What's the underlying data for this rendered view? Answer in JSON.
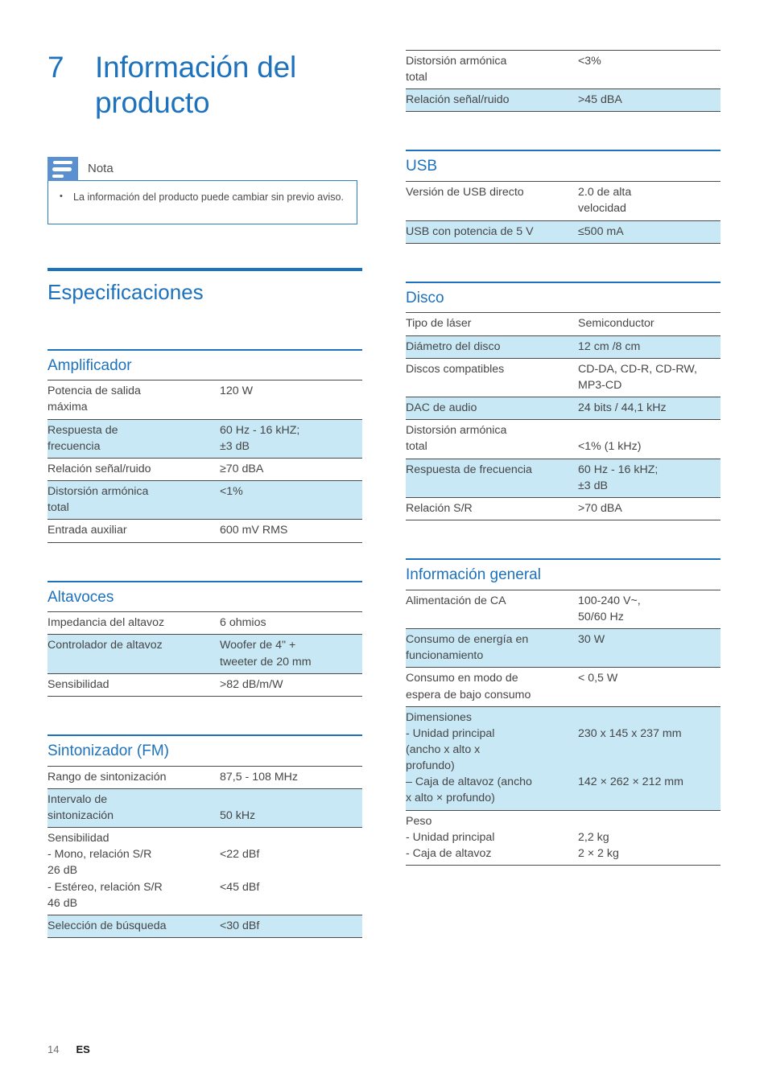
{
  "chapter": {
    "number": "7",
    "title": "Información del producto"
  },
  "note": {
    "label": "Nota",
    "bullet": "•",
    "text": "La información del producto puede cambiar sin previo aviso."
  },
  "specifications": {
    "heading": "Especificaciones"
  },
  "sections": {
    "amplificador": {
      "title": "Amplificador",
      "rows": [
        {
          "label": "Potencia de salida\nmáxima",
          "value": "120 W",
          "highlight": false
        },
        {
          "label": "Respuesta de\nfrecuencia",
          "value": "60 Hz - 16 kHZ;\n±3 dB",
          "highlight": true
        },
        {
          "label": "Relación señal/ruido",
          "value": "≥70 dBA",
          "highlight": false
        },
        {
          "label": "Distorsión armónica\ntotal",
          "value": "<1%",
          "highlight": true
        },
        {
          "label": "Entrada auxiliar",
          "value": "600 mV RMS",
          "highlight": false
        }
      ]
    },
    "altavoces": {
      "title": "Altavoces",
      "rows": [
        {
          "label": "Impedancia del altavoz",
          "value": "6 ohmios",
          "highlight": false
        },
        {
          "label": "Controlador de altavoz",
          "value": "Woofer de 4\" +\ntweeter de 20 mm",
          "highlight": true
        },
        {
          "label": "Sensibilidad",
          "value": ">82 dB/m/W",
          "highlight": false
        }
      ]
    },
    "sintonizador": {
      "title": "Sintonizador (FM)",
      "rows": [
        {
          "label": "Rango de sintonización",
          "value": "87,5 - 108 MHz",
          "highlight": false
        },
        {
          "label": "Intervalo de\nsintonización",
          "value": "\n50 kHz",
          "highlight": true
        },
        {
          "label": "Sensibilidad\n- Mono, relación S/R\n26 dB\n- Estéreo, relación S/R\n46 dB",
          "value": "\n<22 dBf\n\n<45 dBf",
          "highlight": false
        },
        {
          "label": "Selección de búsqueda",
          "value": "<30 dBf",
          "highlight": true
        }
      ]
    },
    "tuner_continued": {
      "rows": [
        {
          "label": "Distorsión armónica\ntotal",
          "value": "<3%",
          "highlight": false
        },
        {
          "label": "Relación señal/ruido",
          "value": ">45 dBA",
          "highlight": true
        }
      ]
    },
    "usb": {
      "title": "USB",
      "rows": [
        {
          "label": "Versión de USB directo",
          "value": "2.0 de alta\nvelocidad",
          "highlight": false
        },
        {
          "label": "USB con potencia de 5 V",
          "value": "≤500 mA",
          "highlight": true
        }
      ]
    },
    "disco": {
      "title": "Disco",
      "rows": [
        {
          "label": "Tipo de láser",
          "value": "Semiconductor",
          "highlight": false
        },
        {
          "label": "Diámetro del disco",
          "value": "12 cm /8 cm",
          "highlight": true
        },
        {
          "label": "Discos compatibles",
          "value": "CD-DA, CD-R, CD-RW, MP3-CD",
          "highlight": false
        },
        {
          "label": "DAC de audio",
          "value": "24 bits / 44,1 kHz",
          "highlight": true
        },
        {
          "label": "Distorsión armónica\ntotal",
          "value": "\n<1% (1 kHz)",
          "highlight": false
        },
        {
          "label": "Respuesta de frecuencia",
          "value": "60 Hz - 16 kHZ;\n±3 dB",
          "highlight": true
        },
        {
          "label": "Relación S/R",
          "value": ">70 dBA",
          "highlight": false
        }
      ]
    },
    "general": {
      "title": "Información general",
      "rows": [
        {
          "label": "Alimentación de CA",
          "value": "100-240 V~,\n50/60 Hz",
          "highlight": false
        },
        {
          "label": "Consumo de energía en\nfuncionamiento",
          "value": "30 W",
          "highlight": true
        },
        {
          "label": "Consumo en modo de\nespera de bajo consumo",
          "value": "< 0,5 W",
          "highlight": false
        },
        {
          "label": "Dimensiones\n- Unidad principal\n(ancho x alto x\nprofundo)\n– Caja de altavoz (ancho\nx alto × profundo)",
          "value": "\n230 x 145 x 237 mm\n\n\n142 × 262 × 212 mm",
          "highlight": true
        },
        {
          "label": "Peso\n- Unidad principal\n- Caja de altavoz",
          "value": "\n2,2 kg\n2 × 2 kg",
          "highlight": false
        }
      ]
    }
  },
  "footer": {
    "page_number": "14",
    "language": "ES"
  },
  "colors": {
    "accent_blue": "#1d72bd",
    "highlight_cyan": "#c8e8f6",
    "note_icon_blue": "#5a8fd0",
    "body_text": "#464646"
  }
}
